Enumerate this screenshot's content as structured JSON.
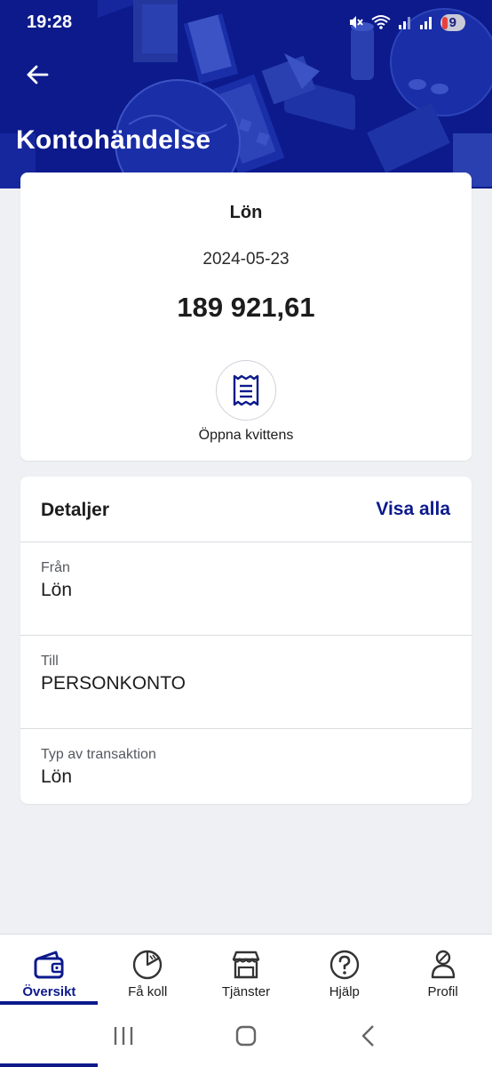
{
  "status_bar": {
    "time": "19:28",
    "notification_count": "9"
  },
  "header": {
    "title": "Kontohändelse",
    "background_color": "#0c1a8c"
  },
  "summary": {
    "title": "Lön",
    "date": "2024-05-23",
    "amount": "189 921,61",
    "receipt_label": "Öppna kvittens"
  },
  "details": {
    "title": "Detaljer",
    "show_all_label": "Visa alla",
    "rows": [
      {
        "label": "Från",
        "value": "Lön"
      },
      {
        "label": "Till",
        "value": "PERSONKONTO"
      },
      {
        "label": "Typ av transaktion",
        "value": "Lön"
      }
    ]
  },
  "bottom_nav": {
    "items": [
      {
        "label": "Översikt",
        "icon": "wallet-icon",
        "active": true
      },
      {
        "label": "Få koll",
        "icon": "pie-chart-icon",
        "active": false
      },
      {
        "label": "Tjänster",
        "icon": "store-icon",
        "active": false
      },
      {
        "label": "Hjälp",
        "icon": "help-icon",
        "active": false
      },
      {
        "label": "Profil",
        "icon": "profile-icon",
        "active": false
      }
    ]
  },
  "accent_color": "#0c1a8c"
}
